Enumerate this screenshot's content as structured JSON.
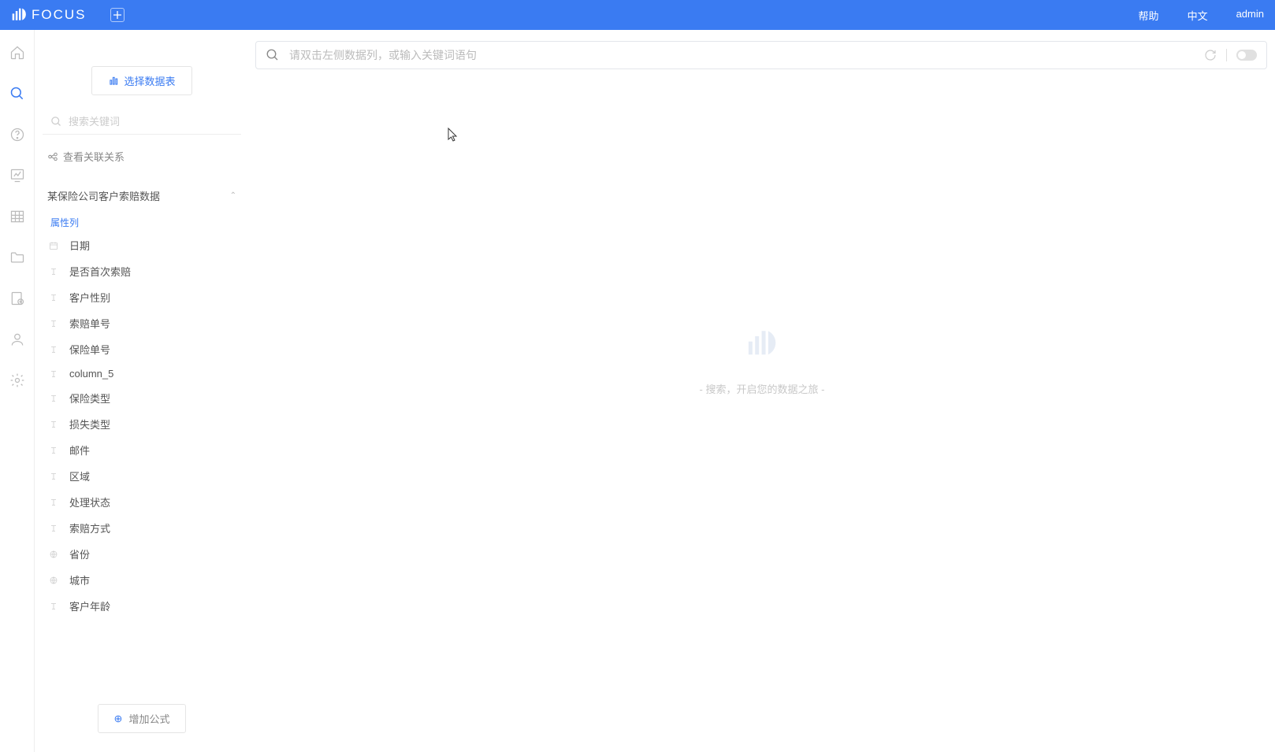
{
  "header": {
    "brand": "FOCUS",
    "help": "帮助",
    "language": "中文",
    "user": "admin"
  },
  "sidebar": {
    "select_table": "选择数据表",
    "search_placeholder": "搜索关键词",
    "relation": "查看关联关系",
    "tree_root": "某保险公司客户索赔数据",
    "section_label": "属性列",
    "columns": [
      {
        "type": "date",
        "name": "日期"
      },
      {
        "type": "text",
        "name": "是否首次索赔"
      },
      {
        "type": "text",
        "name": "客户性别"
      },
      {
        "type": "text",
        "name": "索赔单号"
      },
      {
        "type": "text",
        "name": "保险单号"
      },
      {
        "type": "text",
        "name": "column_5"
      },
      {
        "type": "text",
        "name": "保险类型"
      },
      {
        "type": "text",
        "name": "损失类型"
      },
      {
        "type": "text",
        "name": "邮件"
      },
      {
        "type": "text",
        "name": "区域"
      },
      {
        "type": "text",
        "name": "处理状态"
      },
      {
        "type": "text",
        "name": "索赔方式"
      },
      {
        "type": "geo",
        "name": "省份"
      },
      {
        "type": "geo",
        "name": "城市"
      },
      {
        "type": "text",
        "name": "客户年龄"
      }
    ],
    "add_formula": "增加公式"
  },
  "main": {
    "search_placeholder": "请双击左侧数据列，或输入关键词语句",
    "empty_hint": "- 搜索，开启您的数据之旅 -"
  }
}
